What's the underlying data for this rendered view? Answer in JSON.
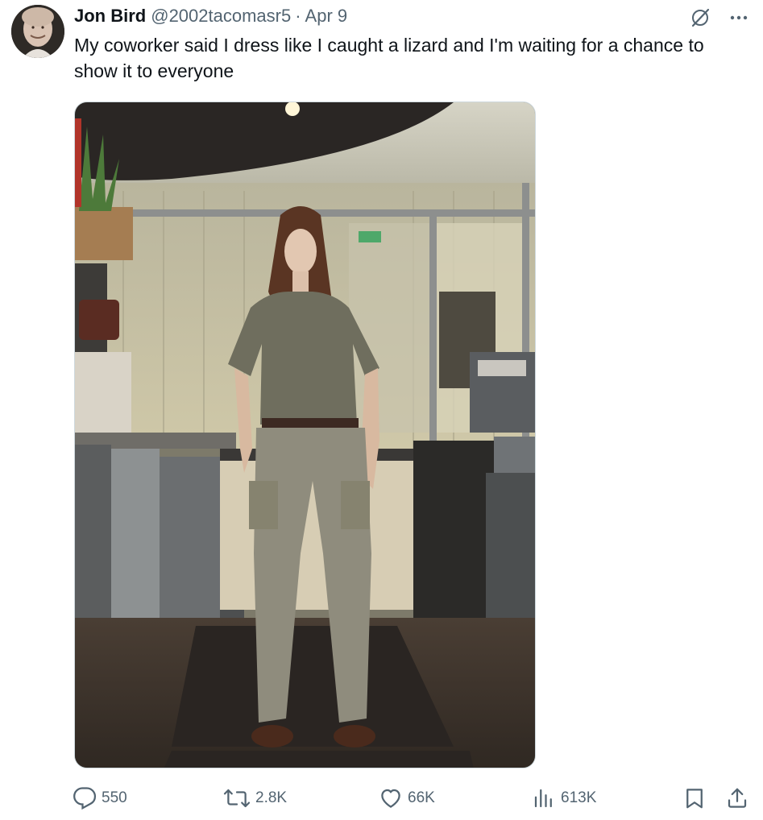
{
  "user": {
    "name": "Jon Bird",
    "handle": "@2002tacomasr5",
    "separator": "·",
    "date": "Apr 9"
  },
  "tweet": {
    "text": "My coworker said I dress like I caught a lizard and I'm waiting for a chance to show it to everyone"
  },
  "icons": {
    "avatar": "profile-photo",
    "grok": "grok-icon",
    "more": "more-icon",
    "reply": "reply-icon",
    "retweet": "retweet-icon",
    "like": "heart-icon",
    "views": "views-chart-icon",
    "bookmark": "bookmark-icon",
    "share": "share-icon"
  },
  "actions": {
    "replies": "550",
    "reposts": "2.8K",
    "likes": "66K",
    "views": "613K"
  },
  "colors": {
    "text": "#0f1419",
    "secondary": "#536471",
    "border": "#cfd9de"
  }
}
